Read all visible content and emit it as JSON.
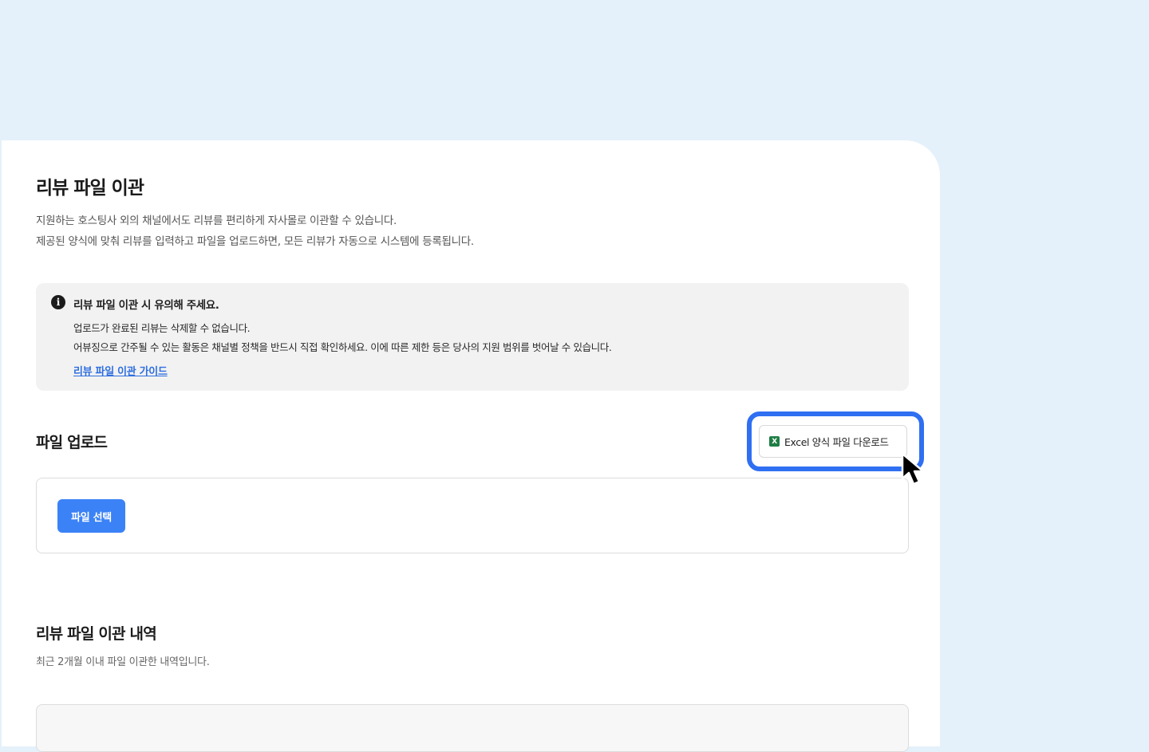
{
  "page": {
    "title": "리뷰 파일 이관",
    "description_lines": [
      "지원하는 호스팅사 외의 채널에서도 리뷰를 편리하게 자사몰로 이관할 수 있습니다.",
      "제공된 양식에 맞춰 리뷰를 입력하고 파일을 업로드하면, 모든 리뷰가 자동으로 시스템에 등록됩니다."
    ]
  },
  "notice": {
    "icon": "info-icon",
    "title": "리뷰 파일 이관 시 유의해 주세요.",
    "lines": [
      "업로드가 완료된 리뷰는 삭제할 수 없습니다.",
      "어뷰징으로 간주될 수 있는 활동은 채널별 정책을 반드시 직접 확인하세요. 이에 따른 제한 등은 당사의 지원 범위를 벗어날 수 있습니다."
    ],
    "link_label": "리뷰 파일 이관 가이드"
  },
  "upload": {
    "title": "파일 업로드",
    "excel_button_label": "Excel 양식 파일 다운로드",
    "excel_icon_letter": "X",
    "file_select_label": "파일 선택"
  },
  "history": {
    "title": "리뷰 파일 이관 내역",
    "description": "최근 2개월 이내 파일 이관한 내역입니다."
  },
  "colors": {
    "background": "#e4f1fa",
    "primary": "#3b82f6",
    "highlight": "#2f6ff2",
    "link": "#2f6fe0",
    "excel": "#1e7e45"
  }
}
